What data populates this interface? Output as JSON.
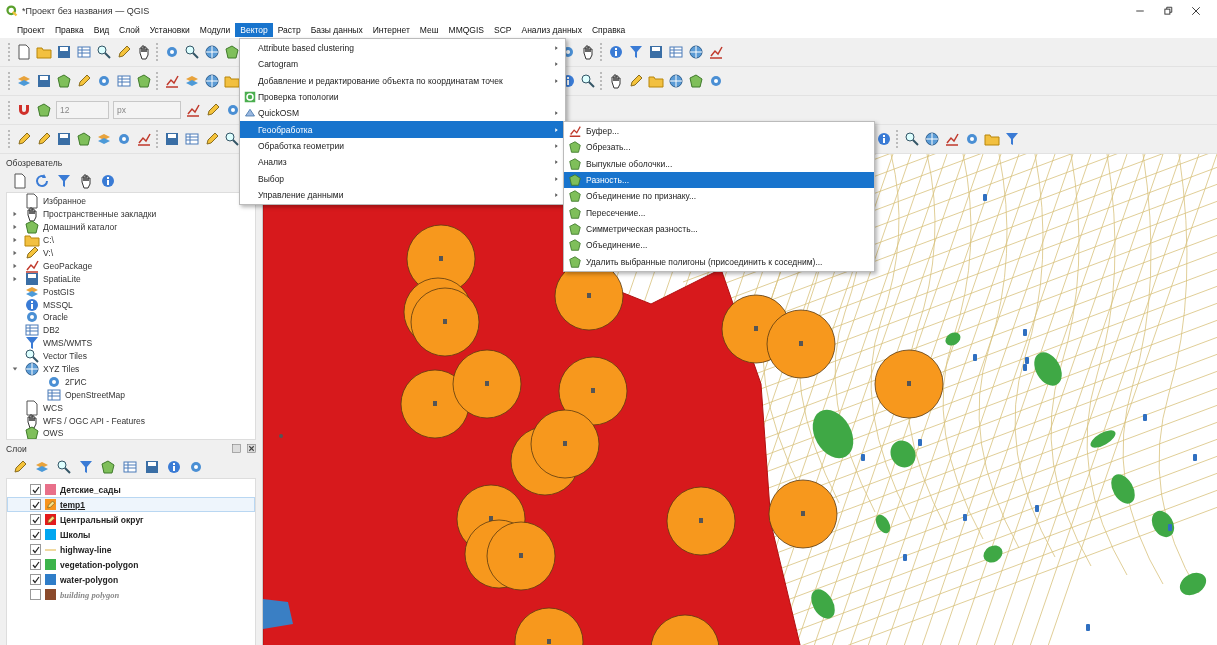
{
  "window": {
    "title": "*Проект без названия — QGIS"
  },
  "menu_bar": [
    {
      "label": "Проект",
      "selected": false
    },
    {
      "label": "Правка",
      "selected": false
    },
    {
      "label": "Вид",
      "selected": false
    },
    {
      "label": "Слой",
      "selected": false
    },
    {
      "label": "Установки",
      "selected": false
    },
    {
      "label": "Модули",
      "selected": false
    },
    {
      "label": "Вектор",
      "selected": true
    },
    {
      "label": "Растр",
      "selected": false
    },
    {
      "label": "Базы данных",
      "selected": false
    },
    {
      "label": "Интернет",
      "selected": false
    },
    {
      "label": "Меш",
      "selected": false
    },
    {
      "label": "MMQGIS",
      "selected": false
    },
    {
      "label": "SCP",
      "selected": false
    },
    {
      "label": "Анализ данных",
      "selected": false
    },
    {
      "label": "Справка",
      "selected": false
    }
  ],
  "snapping_toolbar": {
    "tolerance": "12",
    "unit": "px"
  },
  "vector_menu": [
    {
      "label": "Attribute based clustering",
      "kind": "plain",
      "submenu": true,
      "selected": false
    },
    {
      "label": "Cartogram",
      "kind": "plain",
      "submenu": true,
      "selected": false
    },
    {
      "label": "Добавление и редактирование объекта по координатам точек",
      "kind": "plain",
      "submenu": true,
      "selected": false
    },
    {
      "label": "Проверка топологии",
      "kind": "plugin",
      "submenu": false,
      "selected": false
    },
    {
      "label": "QuickOSM",
      "kind": "plugin",
      "submenu": true,
      "selected": false
    },
    {
      "label": "Геообработка",
      "kind": "plain",
      "submenu": true,
      "selected": true
    },
    {
      "label": "Обработка геометрии",
      "kind": "plain",
      "submenu": true,
      "selected": false
    },
    {
      "label": "Анализ",
      "kind": "plain",
      "submenu": true,
      "selected": false
    },
    {
      "label": "Выбор",
      "kind": "plain",
      "submenu": true,
      "selected": false
    },
    {
      "label": "Управление данными",
      "kind": "plain",
      "submenu": true,
      "selected": false
    }
  ],
  "geoprocessing_menu": [
    {
      "label": "Буфер...",
      "selected": false
    },
    {
      "label": "Обрезать...",
      "selected": false
    },
    {
      "label": "Выпуклые оболочки...",
      "selected": false
    },
    {
      "label": "Разность...",
      "selected": true
    },
    {
      "label": "Объединение по признаку...",
      "selected": false
    },
    {
      "label": "Пересечение...",
      "selected": false
    },
    {
      "label": "Симметрическая разность...",
      "selected": false
    },
    {
      "label": "Объединение...",
      "selected": false
    },
    {
      "label": "Удалить выбранные полигоны (присоединить к соседним)...",
      "selected": false
    }
  ],
  "browser": {
    "title": "Обозреватель",
    "items": [
      {
        "label": "Избранное"
      },
      {
        "label": "Пространственные закладки",
        "expanded": false
      },
      {
        "label": "Домашний каталог",
        "expanded": false
      },
      {
        "label": "C:\\",
        "expanded": false
      },
      {
        "label": "V:\\",
        "expanded": false
      },
      {
        "label": "GeoPackage",
        "expanded": false
      },
      {
        "label": "SpatiaLite",
        "expanded": false
      },
      {
        "label": "PostGIS"
      },
      {
        "label": "MSSQL"
      },
      {
        "label": "Oracle"
      },
      {
        "label": "DB2"
      },
      {
        "label": "WMS/WMTS"
      },
      {
        "label": "Vector Tiles"
      },
      {
        "label": "XYZ Tiles",
        "expanded": true,
        "children": [
          {
            "label": "2ГИС"
          },
          {
            "label": "OpenStreetMap"
          }
        ]
      },
      {
        "label": "WCS"
      },
      {
        "label": "WFS / OGC API - Features"
      },
      {
        "label": "OWS"
      }
    ]
  },
  "layers": {
    "title": "Слои",
    "items": [
      {
        "name": "Детские_сады",
        "checked": true,
        "selected": false,
        "kind": "polygon",
        "color": "#e8708a",
        "editing": false
      },
      {
        "name": "temp1",
        "checked": true,
        "selected": true,
        "kind": "polygon",
        "color": "#f7941d",
        "editing": true
      },
      {
        "name": "Центральный округ",
        "checked": true,
        "selected": false,
        "kind": "polygon",
        "color": "#e31a1c",
        "editing": true
      },
      {
        "name": "Школы",
        "checked": true,
        "selected": false,
        "kind": "polygon",
        "color": "#00a6f0",
        "editing": false
      },
      {
        "name": "highway-line",
        "checked": true,
        "selected": false,
        "kind": "line",
        "color": "#f0d9a0",
        "editing": false
      },
      {
        "name": "vegetation-polygon",
        "checked": true,
        "selected": false,
        "kind": "polygon",
        "color": "#3cb44b",
        "editing": false
      },
      {
        "name": "water-polygon",
        "checked": true,
        "selected": false,
        "kind": "polygon",
        "color": "#2f7dc8",
        "editing": false
      },
      {
        "name": "building polygon",
        "checked": false,
        "selected": false,
        "kind": "polygon",
        "color": "#8b4a2b",
        "editing": false
      }
    ]
  }
}
